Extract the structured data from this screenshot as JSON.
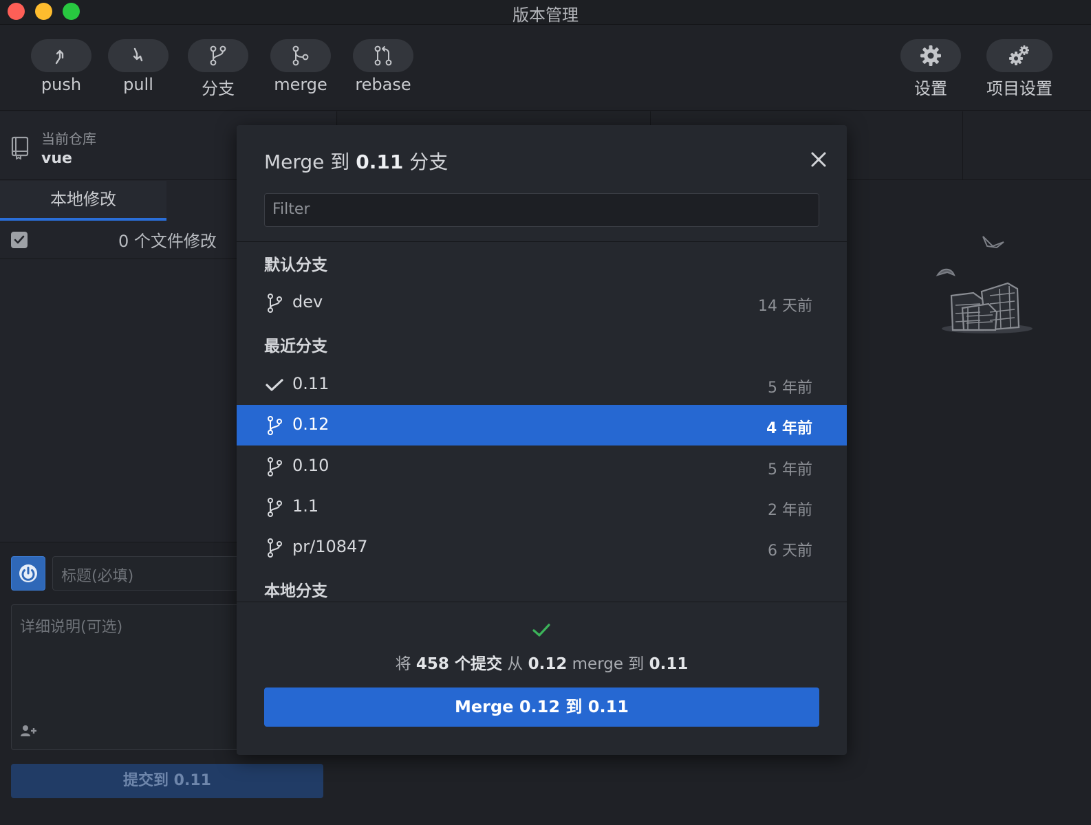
{
  "window": {
    "title": "版本管理"
  },
  "toolbar": {
    "push": "push",
    "pull": "pull",
    "branch": "分支",
    "merge": "merge",
    "rebase": "rebase",
    "settings": "设置",
    "project_settings": "项目设置"
  },
  "repo": {
    "caption": "当前仓库",
    "name": "vue"
  },
  "left": {
    "tab_local": "本地修改",
    "changes_text": "0 个文件修改",
    "title_placeholder": "标题(必填)",
    "desc_placeholder": "详细说明(可选)",
    "commit_button": "提交到 0.11"
  },
  "modal": {
    "title_prefix": "Merge 到",
    "title_branch": "0.11",
    "title_suffix": "分支",
    "filter_placeholder": "Filter",
    "groups": {
      "default": "默认分支",
      "recent": "最近分支",
      "local": "本地分支"
    },
    "default_branches": [
      {
        "name": "dev",
        "time": "14 天前"
      }
    ],
    "recent_branches": [
      {
        "name": "0.11",
        "time": "5 年前",
        "current": true
      },
      {
        "name": "0.12",
        "time": "4 年前",
        "selected": true
      },
      {
        "name": "0.10",
        "time": "5 年前"
      },
      {
        "name": "1.1",
        "time": "2 年前"
      },
      {
        "name": "pr/10847",
        "time": "6 天前"
      }
    ],
    "summary": {
      "w1": "将",
      "count": "458 个提交",
      "w2": "从",
      "from": "0.12",
      "w3": "merge 到",
      "to": "0.11"
    },
    "merge_button": "Merge 0.12 到 0.11"
  },
  "colors": {
    "accent": "#2668d2",
    "success": "#3cb45a",
    "background": "#1f2126"
  }
}
